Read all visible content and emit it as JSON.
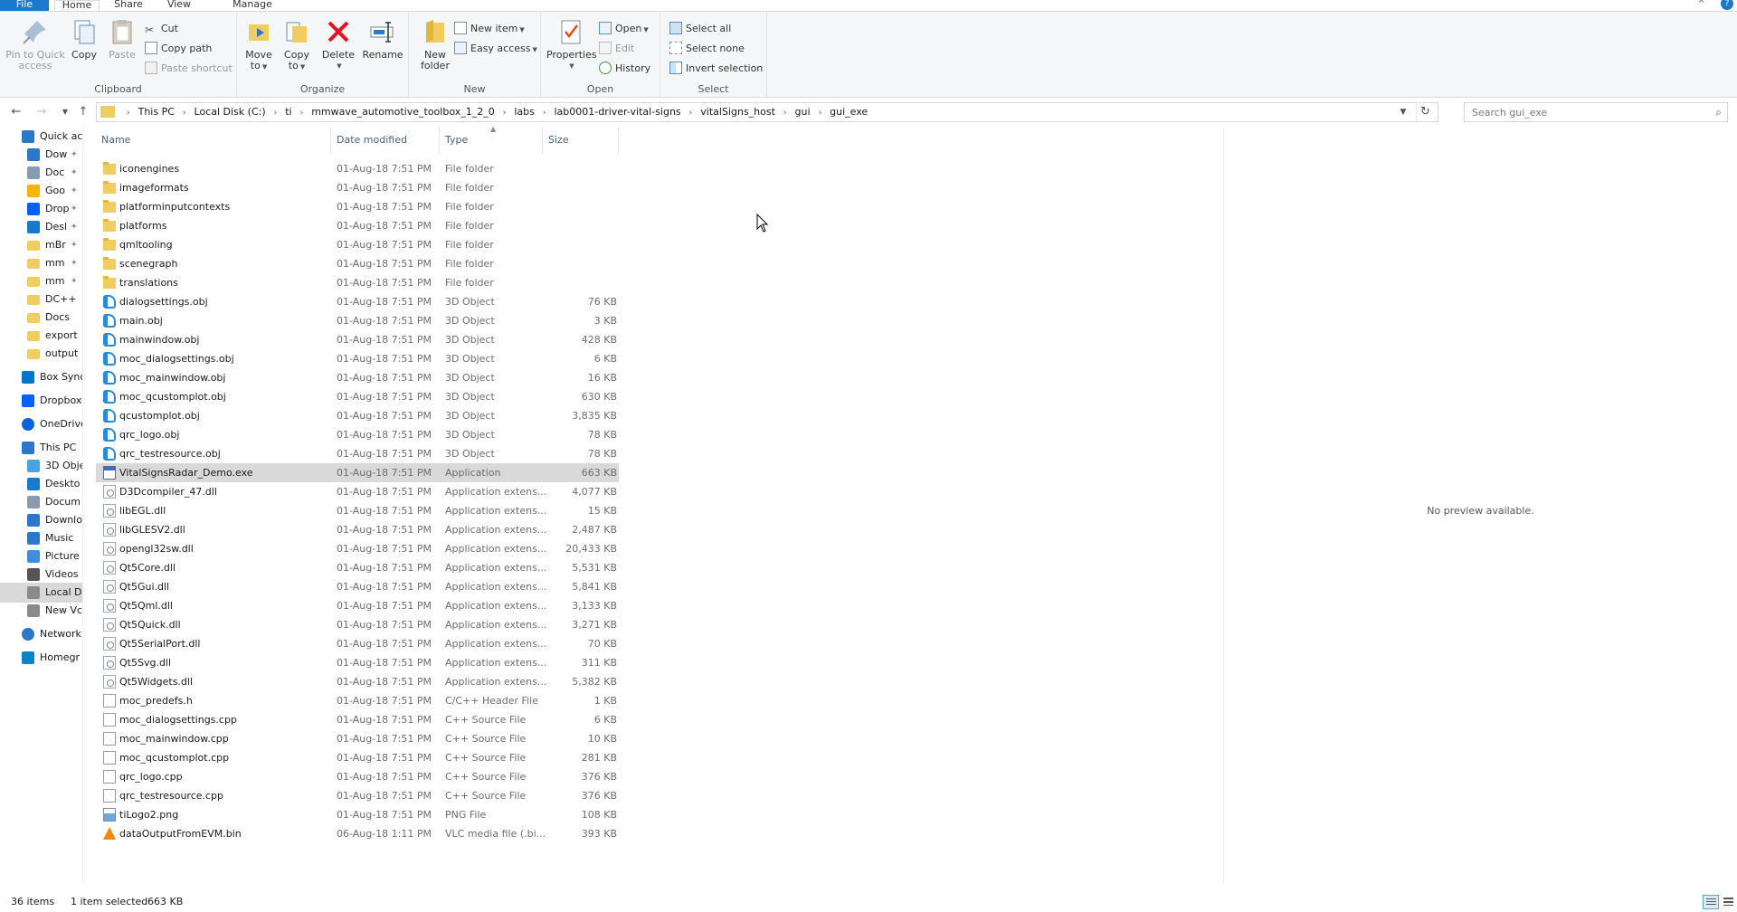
{
  "ribbon_tabs": {
    "file": "File",
    "home": "Home",
    "share": "Share",
    "view": "View",
    "manage": "Manage"
  },
  "window": {
    "help": "?"
  },
  "ribbon": {
    "clipboard": {
      "label": "Clipboard",
      "pin_line1": "Pin to Quick",
      "pin_line2": "access",
      "copy": "Copy",
      "paste": "Paste",
      "cut": "Cut",
      "copy_path": "Copy path",
      "paste_shortcut": "Paste shortcut"
    },
    "organize": {
      "label": "Organize",
      "move_line1": "Move",
      "move_line2": "to",
      "copyto_line1": "Copy",
      "copyto_line2": "to",
      "delete": "Delete",
      "rename": "Rename"
    },
    "new": {
      "label": "New",
      "folder_line1": "New",
      "folder_line2": "folder",
      "new_item": "New item",
      "easy_access": "Easy access"
    },
    "open": {
      "label": "Open",
      "properties": "Properties",
      "open": "Open",
      "edit": "Edit",
      "history": "History"
    },
    "select": {
      "label": "Select",
      "select_all": "Select all",
      "select_none": "Select none",
      "invert_selection": "Invert selection"
    }
  },
  "address": {
    "crumbs": [
      "This PC",
      "Local Disk (C:)",
      "ti",
      "mmwave_automotive_toolbox_1_2_0",
      "labs",
      "lab0001-driver-vital-signs",
      "vitalSigns_host",
      "gui",
      "gui_exe"
    ]
  },
  "search": {
    "placeholder": "Search gui_exe"
  },
  "nav": [
    {
      "label": "Quick ac",
      "icon": "star-icon"
    },
    {
      "label": "Dow",
      "icon": "download-icon"
    },
    {
      "label": "Doc",
      "icon": "document-icon"
    },
    {
      "label": "Goo",
      "icon": "google-drive-icon"
    },
    {
      "label": "Drop",
      "icon": "dropbox-icon"
    },
    {
      "label": "Desl",
      "icon": "desktop-icon"
    },
    {
      "label": "mBr",
      "icon": "folder-icon"
    },
    {
      "label": "mm",
      "icon": "folder-icon"
    },
    {
      "label": "mm",
      "icon": "folder-icon"
    },
    {
      "label": "DC++",
      "icon": "folder-icon"
    },
    {
      "label": "Docs",
      "icon": "folder-icon"
    },
    {
      "label": "export",
      "icon": "folder-icon"
    },
    {
      "label": "output",
      "icon": "folder-icon"
    },
    {
      "label": "Box Sync",
      "icon": "box-icon"
    },
    {
      "label": "Dropbox",
      "icon": "dropbox-icon"
    },
    {
      "label": "OneDrive",
      "icon": "cloud-icon"
    },
    {
      "label": "This PC",
      "icon": "computer-icon"
    },
    {
      "label": "3D Obje",
      "icon": "cube-icon"
    },
    {
      "label": "Deskto",
      "icon": "desktop-icon"
    },
    {
      "label": "Docum",
      "icon": "document-icon"
    },
    {
      "label": "Downlo",
      "icon": "download-icon"
    },
    {
      "label": "Music",
      "icon": "music-icon"
    },
    {
      "label": "Picture",
      "icon": "picture-icon"
    },
    {
      "label": "Videos",
      "icon": "video-icon"
    },
    {
      "label": "Local D",
      "icon": "drive-icon"
    },
    {
      "label": "New Vc",
      "icon": "drive-icon"
    },
    {
      "label": "Network",
      "icon": "network-icon"
    },
    {
      "label": "Homegr",
      "icon": "homegroup-icon"
    }
  ],
  "columns": {
    "name": "Name",
    "date": "Date modified",
    "type": "Type",
    "size": "Size"
  },
  "files": [
    {
      "name": "iconengines",
      "date": "01-Aug-18 7:51 PM",
      "type": "File folder",
      "size": "",
      "kind": "folder"
    },
    {
      "name": "imageformats",
      "date": "01-Aug-18 7:51 PM",
      "type": "File folder",
      "size": "",
      "kind": "folder"
    },
    {
      "name": "platforminputcontexts",
      "date": "01-Aug-18 7:51 PM",
      "type": "File folder",
      "size": "",
      "kind": "folder"
    },
    {
      "name": "platforms",
      "date": "01-Aug-18 7:51 PM",
      "type": "File folder",
      "size": "",
      "kind": "folder"
    },
    {
      "name": "qmltooling",
      "date": "01-Aug-18 7:51 PM",
      "type": "File folder",
      "size": "",
      "kind": "folder"
    },
    {
      "name": "scenegraph",
      "date": "01-Aug-18 7:51 PM",
      "type": "File folder",
      "size": "",
      "kind": "folder"
    },
    {
      "name": "translations",
      "date": "01-Aug-18 7:51 PM",
      "type": "File folder",
      "size": "",
      "kind": "folder"
    },
    {
      "name": "dialogsettings.obj",
      "date": "01-Aug-18 7:51 PM",
      "type": "3D Object",
      "size": "76 KB",
      "kind": "obj"
    },
    {
      "name": "main.obj",
      "date": "01-Aug-18 7:51 PM",
      "type": "3D Object",
      "size": "3 KB",
      "kind": "obj"
    },
    {
      "name": "mainwindow.obj",
      "date": "01-Aug-18 7:51 PM",
      "type": "3D Object",
      "size": "428 KB",
      "kind": "obj"
    },
    {
      "name": "moc_dialogsettings.obj",
      "date": "01-Aug-18 7:51 PM",
      "type": "3D Object",
      "size": "6 KB",
      "kind": "obj"
    },
    {
      "name": "moc_mainwindow.obj",
      "date": "01-Aug-18 7:51 PM",
      "type": "3D Object",
      "size": "16 KB",
      "kind": "obj"
    },
    {
      "name": "moc_qcustomplot.obj",
      "date": "01-Aug-18 7:51 PM",
      "type": "3D Object",
      "size": "630 KB",
      "kind": "obj"
    },
    {
      "name": "qcustomplot.obj",
      "date": "01-Aug-18 7:51 PM",
      "type": "3D Object",
      "size": "3,835 KB",
      "kind": "obj"
    },
    {
      "name": "qrc_logo.obj",
      "date": "01-Aug-18 7:51 PM",
      "type": "3D Object",
      "size": "78 KB",
      "kind": "obj"
    },
    {
      "name": "qrc_testresource.obj",
      "date": "01-Aug-18 7:51 PM",
      "type": "3D Object",
      "size": "78 KB",
      "kind": "obj"
    },
    {
      "name": "VitalSignsRadar_Demo.exe",
      "date": "01-Aug-18 7:51 PM",
      "type": "Application",
      "size": "663 KB",
      "kind": "exe",
      "selected": true
    },
    {
      "name": "D3Dcompiler_47.dll",
      "date": "01-Aug-18 7:51 PM",
      "type": "Application extens...",
      "size": "4,077 KB",
      "kind": "dll"
    },
    {
      "name": "libEGL.dll",
      "date": "01-Aug-18 7:51 PM",
      "type": "Application extens...",
      "size": "15 KB",
      "kind": "dll"
    },
    {
      "name": "libGLESV2.dll",
      "date": "01-Aug-18 7:51 PM",
      "type": "Application extens...",
      "size": "2,487 KB",
      "kind": "dll"
    },
    {
      "name": "opengl32sw.dll",
      "date": "01-Aug-18 7:51 PM",
      "type": "Application extens...",
      "size": "20,433 KB",
      "kind": "dll"
    },
    {
      "name": "Qt5Core.dll",
      "date": "01-Aug-18 7:51 PM",
      "type": "Application extens...",
      "size": "5,531 KB",
      "kind": "dll"
    },
    {
      "name": "Qt5Gui.dll",
      "date": "01-Aug-18 7:51 PM",
      "type": "Application extens...",
      "size": "5,841 KB",
      "kind": "dll"
    },
    {
      "name": "Qt5Qml.dll",
      "date": "01-Aug-18 7:51 PM",
      "type": "Application extens...",
      "size": "3,133 KB",
      "kind": "dll"
    },
    {
      "name": "Qt5Quick.dll",
      "date": "01-Aug-18 7:51 PM",
      "type": "Application extens...",
      "size": "3,271 KB",
      "kind": "dll"
    },
    {
      "name": "Qt5SerialPort.dll",
      "date": "01-Aug-18 7:51 PM",
      "type": "Application extens...",
      "size": "70 KB",
      "kind": "dll"
    },
    {
      "name": "Qt5Svg.dll",
      "date": "01-Aug-18 7:51 PM",
      "type": "Application extens...",
      "size": "311 KB",
      "kind": "dll"
    },
    {
      "name": "Qt5Widgets.dll",
      "date": "01-Aug-18 7:51 PM",
      "type": "Application extens...",
      "size": "5,382 KB",
      "kind": "dll"
    },
    {
      "name": "moc_predefs.h",
      "date": "01-Aug-18 7:51 PM",
      "type": "C/C++ Header File",
      "size": "1 KB",
      "kind": "doc"
    },
    {
      "name": "moc_dialogsettings.cpp",
      "date": "01-Aug-18 7:51 PM",
      "type": "C++ Source File",
      "size": "6 KB",
      "kind": "doc"
    },
    {
      "name": "moc_mainwindow.cpp",
      "date": "01-Aug-18 7:51 PM",
      "type": "C++ Source File",
      "size": "10 KB",
      "kind": "doc"
    },
    {
      "name": "moc_qcustomplot.cpp",
      "date": "01-Aug-18 7:51 PM",
      "type": "C++ Source File",
      "size": "281 KB",
      "kind": "doc"
    },
    {
      "name": "qrc_logo.cpp",
      "date": "01-Aug-18 7:51 PM",
      "type": "C++ Source File",
      "size": "376 KB",
      "kind": "doc"
    },
    {
      "name": "qrc_testresource.cpp",
      "date": "01-Aug-18 7:51 PM",
      "type": "C++ Source File",
      "size": "376 KB",
      "kind": "doc"
    },
    {
      "name": "tiLogo2.png",
      "date": "01-Aug-18 7:51 PM",
      "type": "PNG File",
      "size": "108 KB",
      "kind": "png"
    },
    {
      "name": "dataOutputFromEVM.bin",
      "date": "06-Aug-18 1:11 PM",
      "type": "VLC media file (.bi...",
      "size": "393 KB",
      "kind": "vlc"
    }
  ],
  "preview": {
    "message": "No preview available."
  },
  "status": {
    "count": "36 items",
    "selection": "1 item selected",
    "selection_size": "663 KB"
  },
  "colors": {
    "accent": "#1979ca",
    "selection": "#d9d9d9",
    "folder": "#f1cc61",
    "delete_red": "#e81123"
  }
}
